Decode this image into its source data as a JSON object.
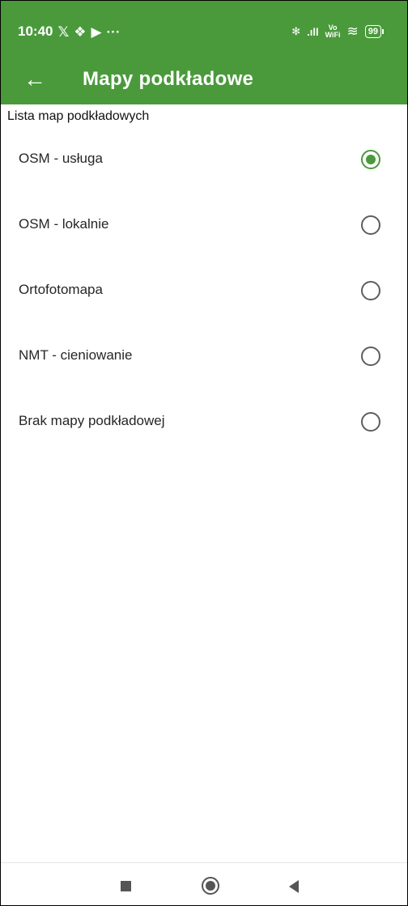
{
  "status_bar": {
    "time": "10:40",
    "left_icons": [
      "x-logo-icon",
      "dropbox-icon",
      "youtube-icon",
      "more-dots-icon"
    ],
    "left_glyphs": [
      "𝕏",
      "❖",
      "▶",
      "···"
    ],
    "right_icons": [
      "bluetooth-icon",
      "signal-icon",
      "vowifi-icon",
      "wifi-icon",
      "battery-icon"
    ],
    "bluetooth_glyph": "✻",
    "signal_glyph": ".ıll",
    "vowifi_top": "Vo",
    "vowifi_bottom": "WiFi",
    "wifi_glyph": "≋",
    "battery": "99"
  },
  "app_bar": {
    "back_glyph": "←",
    "title": "Mapy podkładowe",
    "background": "#4a9a3b"
  },
  "section": {
    "label": "Lista map podkładowych"
  },
  "options": [
    {
      "label": "OSM - usługa",
      "selected": true
    },
    {
      "label": "OSM - lokalnie",
      "selected": false
    },
    {
      "label": "Ortofotomapa",
      "selected": false
    },
    {
      "label": "NMT - cieniowanie",
      "selected": false
    },
    {
      "label": "Brak mapy podkładowej",
      "selected": false
    }
  ],
  "nav_bar": {
    "buttons": [
      "recents-button",
      "home-button",
      "back-button"
    ]
  },
  "colors": {
    "accent": "#4a9a3b",
    "radio_unchecked": "#5d5d5d",
    "text": "#262626"
  }
}
